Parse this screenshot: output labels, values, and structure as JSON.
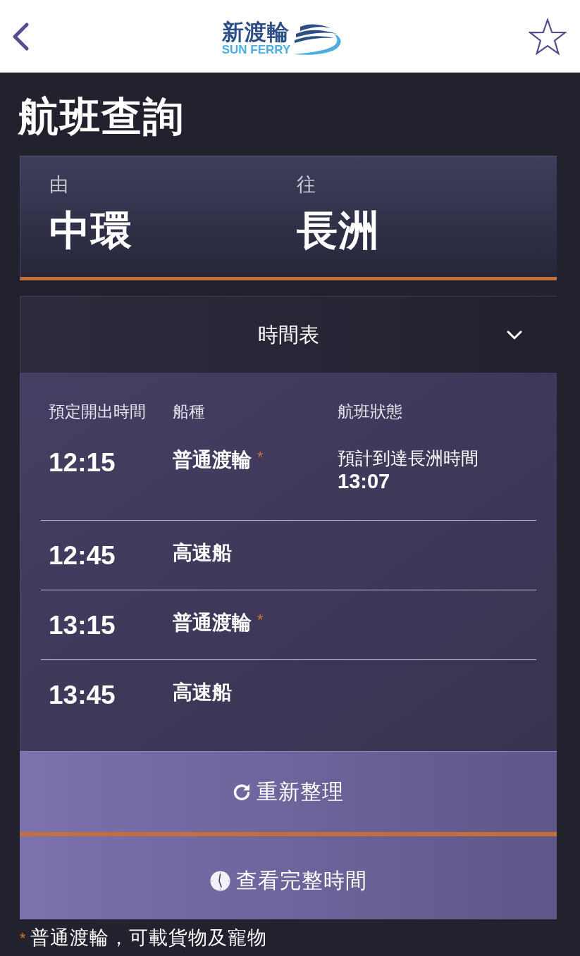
{
  "header": {
    "logo": {
      "wordmark": "新渡輪",
      "subtitle": "SUN FERRY"
    }
  },
  "title": "航班查詢",
  "route": {
    "from_label": "由",
    "from": "中環",
    "to_label": "往",
    "to": "長洲"
  },
  "timetable": {
    "title": "時間表",
    "expanded": true,
    "columns": [
      "預定開出時間",
      "船種",
      "航班狀態"
    ],
    "rows": [
      {
        "time": "12:15",
        "type": "普通渡輪",
        "marker": "*",
        "status_label": "預計到達長洲時間",
        "status_time": "13:07"
      },
      {
        "time": "12:45",
        "type": "高速船"
      },
      {
        "time": "13:15",
        "type": "普通渡輪",
        "marker": "*"
      },
      {
        "time": "13:45",
        "type": "高速船"
      }
    ]
  },
  "buttons": [
    {
      "kind": "refresh",
      "label": "重新整理"
    },
    {
      "kind": "schedule",
      "label": "查看完整時間"
    }
  ],
  "footnote": {
    "marker": "*",
    "text": "普通渡輪，可載貨物及寵物"
  }
}
